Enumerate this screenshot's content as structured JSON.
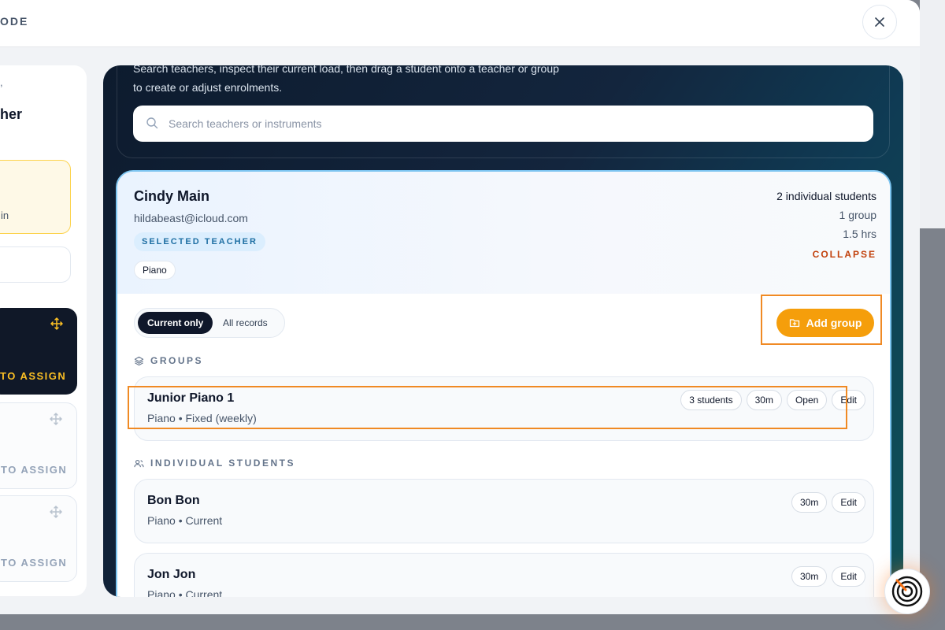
{
  "modal": {
    "title_fragment": "ODE"
  },
  "left_panel": {
    "fragment_top": ",",
    "fragment_title": "her",
    "note_fragment": "in",
    "cards": [
      {
        "label": "TO ASSIGN",
        "variant": "dark"
      },
      {
        "label": "TO ASSIGN",
        "variant": "light"
      },
      {
        "label": "TO ASSIGN",
        "variant": "light"
      }
    ]
  },
  "search": {
    "intro_line1": "Search teachers, inspect their current load, then drag a student onto a teacher or group",
    "intro_line2": "to create or adjust enrolments.",
    "placeholder": "Search teachers or instruments"
  },
  "teacher": {
    "name": "Cindy Main",
    "email": "hildabeast@icloud.com",
    "badge": "SELECTED TEACHER",
    "instrument": "Piano",
    "stats": {
      "individual": "2 individual students",
      "groups": "1 group",
      "hours": "1.5 hrs"
    },
    "collapse_label": "COLLAPSE"
  },
  "filters": {
    "current": "Current only",
    "all": "All records"
  },
  "add_group_label": "Add group",
  "groups_section": {
    "label": "GROUPS",
    "items": [
      {
        "name": "Junior Piano 1",
        "subtitle": "Piano • Fixed (weekly)",
        "students": "3 students",
        "duration": "30m",
        "open": "Open",
        "edit": "Edit"
      }
    ]
  },
  "students_section": {
    "label": "INDIVIDUAL STUDENTS",
    "items": [
      {
        "name": "Bon Bon",
        "subtitle": "Piano • Current",
        "duration": "30m",
        "edit": "Edit"
      },
      {
        "name": "Jon Jon",
        "subtitle": "Piano • Current",
        "duration": "30m",
        "edit": "Edit"
      }
    ]
  },
  "colors": {
    "accent": "#f59e0b",
    "highlight": "#f08a24",
    "selected_border": "#7cc4f0"
  }
}
